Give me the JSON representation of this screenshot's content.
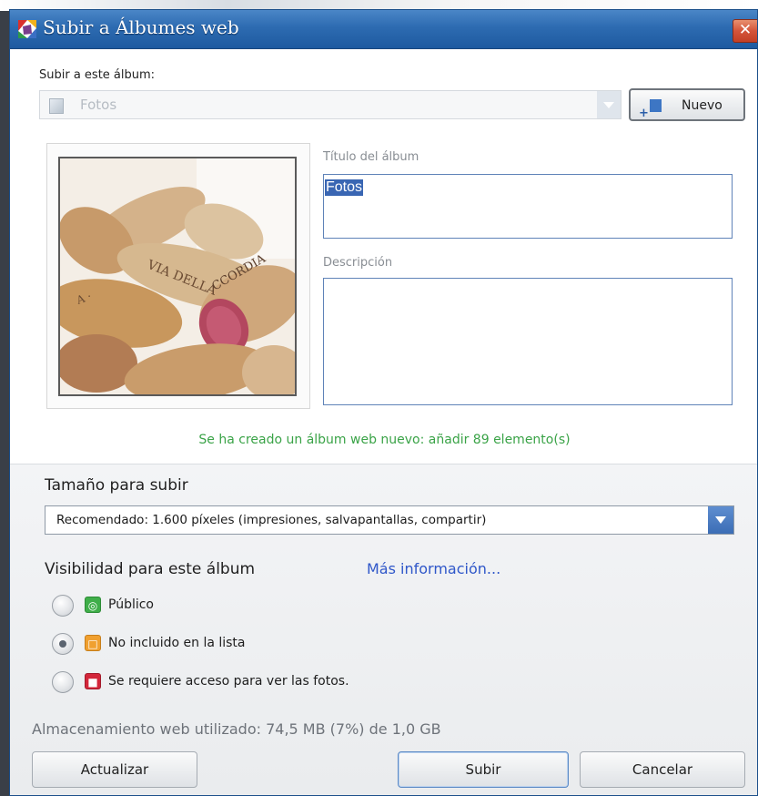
{
  "window": {
    "title": "Subir a Álbumes web",
    "close_glyph": "✕"
  },
  "album": {
    "upload_to_label": "Subir a este álbum:",
    "selected_album": "Fotos",
    "new_button": "Nuevo",
    "title_label": "Título del álbum",
    "title_value": "Fotos",
    "description_label": "Descripción",
    "description_value": ""
  },
  "status_message": "Se ha creado un álbum web nuevo: añadir 89 elemento(s)",
  "upload_size": {
    "label": "Tamaño para subir",
    "selected": "Recomendado: 1.600 píxeles (impresiones, salvapantallas, compartir)"
  },
  "visibility": {
    "label": "Visibilidad para este álbum",
    "more_info_link": "Más información...",
    "options": [
      {
        "label": "Público",
        "icon": "globe-icon",
        "color": "#3fae49",
        "checked": false
      },
      {
        "label": "No incluido en la lista",
        "icon": "padlock-open-icon",
        "color": "#f0a030",
        "checked": true
      },
      {
        "label": "Se requiere acceso para ver las fotos.",
        "icon": "padlock-closed-icon",
        "color": "#d3263a",
        "checked": false
      }
    ]
  },
  "storage_text": "Almacenamiento web utilizado: 74,5 MB (7%) de 1,0 GB",
  "buttons": {
    "refresh": "Actualizar",
    "upload": "Subir",
    "cancel": "Cancelar"
  }
}
